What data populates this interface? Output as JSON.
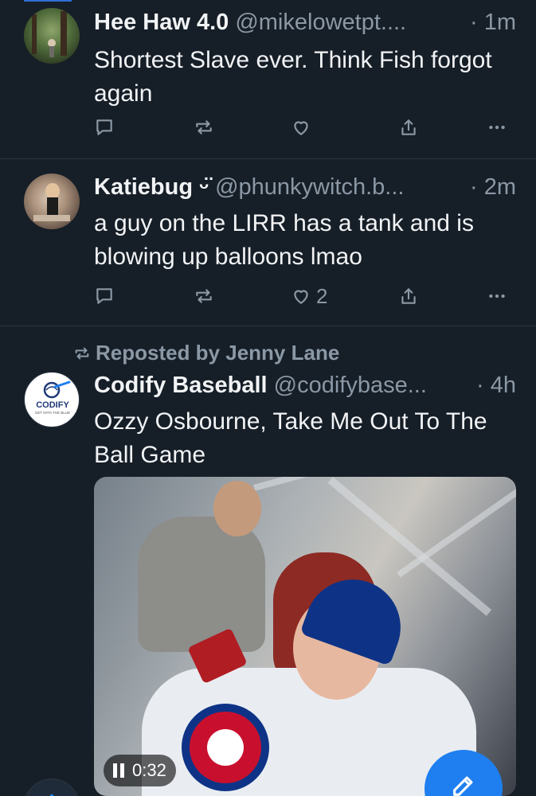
{
  "posts": [
    {
      "name": "Hee Haw 4.0",
      "handle": "@mikelowetpt....",
      "time": "· 1m",
      "text": "Shortest Slave ever. Think Fish forgot again",
      "like_count": ""
    },
    {
      "name": "Katiebug ᵕ̈",
      "handle": "@phunkywitch.b...",
      "time": "· 2m",
      "text": "a guy on the LIRR has a tank and is blowing up balloons lmao",
      "like_count": "2"
    },
    {
      "repost_label": "Reposted by Jenny Lane",
      "name": "Codify Baseball",
      "handle": "@codifybase...",
      "time": "· 4h",
      "text": "Ozzy Osbourne, Take Me Out To The Ball Game",
      "avatar_text": "CODIFY",
      "avatar_subtext": "GET INTO THE BLUE",
      "video_time": "0:32"
    }
  ],
  "icons": {
    "reply": "speech-bubble-icon",
    "repost": "repost-arrows-icon",
    "like": "heart-icon",
    "share": "share-upload-icon",
    "more": "ellipsis-icon",
    "compose": "pencil-edit-icon"
  },
  "colors": {
    "background": "#161e27",
    "accent": "#1f7ff0",
    "muted": "#8b98a5"
  }
}
